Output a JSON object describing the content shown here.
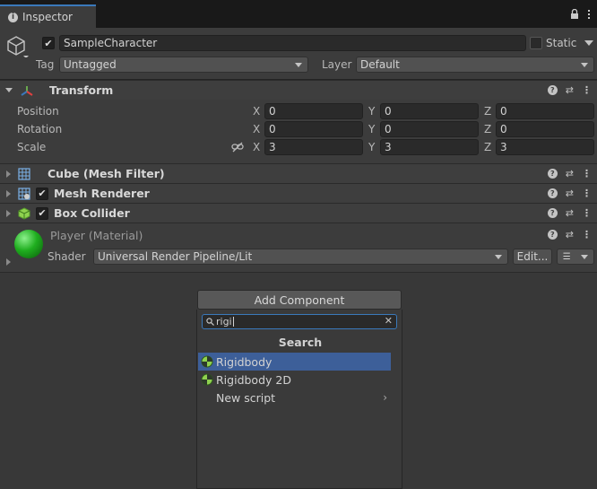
{
  "tab": {
    "title": "Inspector"
  },
  "header": {
    "object_name": "SampleCharacter",
    "static_label": "Static",
    "tag_label": "Tag",
    "tag_value": "Untagged",
    "layer_label": "Layer",
    "layer_value": "Default"
  },
  "transform": {
    "title": "Transform",
    "rows": [
      {
        "label": "Position",
        "x": "0",
        "y": "0",
        "z": "0"
      },
      {
        "label": "Rotation",
        "x": "0",
        "y": "0",
        "z": "0"
      },
      {
        "label": "Scale",
        "x": "3",
        "y": "3",
        "z": "3"
      }
    ],
    "axes": {
      "x": "X",
      "y": "Y",
      "z": "Z"
    }
  },
  "components": [
    {
      "title": "Cube (Mesh Filter)",
      "icon": "mesh-filter-icon"
    },
    {
      "title": "Mesh Renderer",
      "icon": "mesh-renderer-icon"
    },
    {
      "title": "Box Collider",
      "icon": "box-collider-icon"
    }
  ],
  "material": {
    "title": "Player (Material)",
    "shader_label": "Shader",
    "shader_value": "Universal Render Pipeline/Lit",
    "edit_label": "Edit..."
  },
  "add_component": {
    "button_label": "Add Component",
    "search_value": "rigi",
    "list_title": "Search",
    "items": [
      {
        "label": "Rigidbody",
        "selected": true
      },
      {
        "label": "Rigidbody 2D",
        "selected": false
      },
      {
        "label": "New script",
        "selected": false
      }
    ]
  }
}
